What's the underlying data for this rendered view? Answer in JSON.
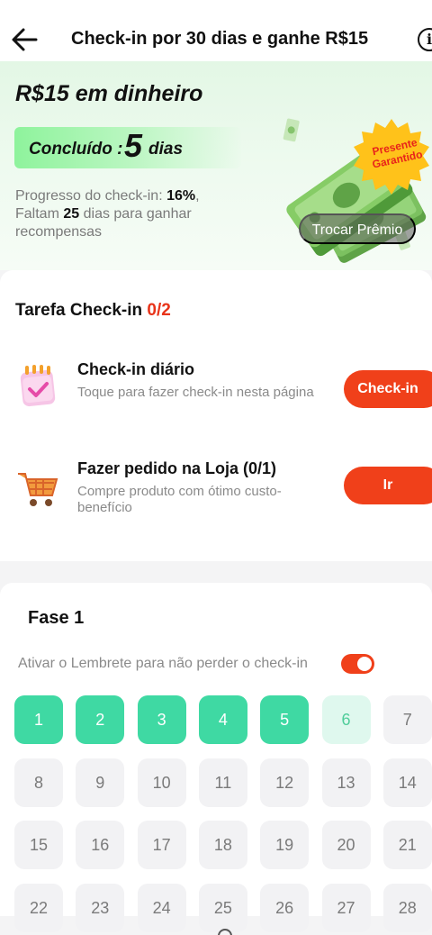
{
  "header": {
    "title": "Check-in por 30 dias e ganhe R$15",
    "info_glyph": "i"
  },
  "hero": {
    "reward_title": "R$15 em dinheiro",
    "done_label": "Concluído :",
    "done_days": "5",
    "done_unit": "dias",
    "progress_label": "Progresso do check-in:",
    "progress_value": "16%",
    "remaining_prefix": "Faltam",
    "remaining_days": "25",
    "remaining_suffix": "dias para ganhar recompensas",
    "badge_line1": "Presente",
    "badge_line2": "Garantido",
    "exchange_button": "Trocar Prêmio"
  },
  "tasks": {
    "heading": "Tarefa Check-in",
    "count": "0/2",
    "items": [
      {
        "title": "Check-in diário",
        "description": "Toque para fazer check-in nesta página",
        "button": "Check-in",
        "icon": "calendar-check-icon"
      },
      {
        "title": "Fazer pedido na Loja  (0/1)",
        "description": "Compre produto com ótimo custo-benefício",
        "button": "Ir",
        "icon": "shopping-cart-icon"
      }
    ]
  },
  "phase": {
    "title": "Fase 1",
    "reminder_text": "Ativar o Lembrete para não perder o check-in",
    "reminder_on": true,
    "days": [
      {
        "label": "1",
        "state": "done"
      },
      {
        "label": "2",
        "state": "done"
      },
      {
        "label": "3",
        "state": "done"
      },
      {
        "label": "4",
        "state": "done"
      },
      {
        "label": "5",
        "state": "done"
      },
      {
        "label": "6",
        "state": "today"
      },
      {
        "label": "7",
        "state": "pending"
      },
      {
        "label": "8",
        "state": "pending"
      },
      {
        "label": "9",
        "state": "pending"
      },
      {
        "label": "10",
        "state": "pending"
      },
      {
        "label": "11",
        "state": "pending"
      },
      {
        "label": "12",
        "state": "pending"
      },
      {
        "label": "13",
        "state": "pending"
      },
      {
        "label": "14",
        "state": "pending"
      },
      {
        "label": "15",
        "state": "pending"
      },
      {
        "label": "16",
        "state": "pending"
      },
      {
        "label": "17",
        "state": "pending"
      },
      {
        "label": "18",
        "state": "pending"
      },
      {
        "label": "19",
        "state": "pending"
      },
      {
        "label": "20",
        "state": "pending"
      },
      {
        "label": "21",
        "state": "pending"
      },
      {
        "label": "22",
        "state": "pending"
      },
      {
        "label": "23",
        "state": "pending"
      },
      {
        "label": "24",
        "state": "pending"
      },
      {
        "label": "25",
        "state": "pending"
      },
      {
        "label": "26",
        "state": "pending"
      },
      {
        "label": "27",
        "state": "pending"
      },
      {
        "label": "28",
        "state": "pending"
      }
    ]
  },
  "colors": {
    "accent": "#f0401a",
    "done_day": "#3fd9a3",
    "today_day": "#dff8ee",
    "pill_green": "#8ef39c"
  }
}
